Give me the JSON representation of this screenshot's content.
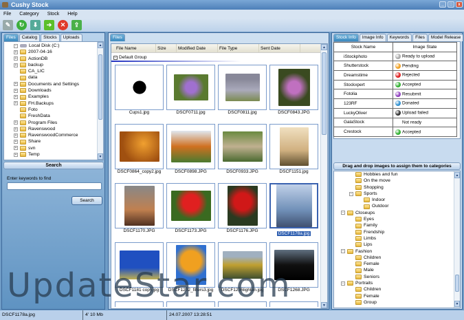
{
  "window": {
    "title": "Cushy Stock"
  },
  "menu": [
    "File",
    "Category",
    "Stock",
    "Help"
  ],
  "toolbar": [
    "wrench-icon",
    "refresh-icon",
    "download-icon",
    "arrow-right-icon",
    "cancel-icon",
    "upload-icon"
  ],
  "left": {
    "tabs": [
      "Files",
      "Catalog",
      "Stocks",
      "Uploads"
    ],
    "tree_root": "Local Disk (C:)",
    "tree": [
      {
        "l": "2007-04-16",
        "e": 1
      },
      {
        "l": "ActionDB",
        "e": 1
      },
      {
        "l": "backup",
        "e": 1
      },
      {
        "l": "CA_LIC",
        "e": 0
      },
      {
        "l": "data",
        "e": 0
      },
      {
        "l": "Documents and Settings",
        "e": 1
      },
      {
        "l": "Downloads",
        "e": 1
      },
      {
        "l": "Examples",
        "e": 1
      },
      {
        "l": "FH.Backups",
        "e": 1
      },
      {
        "l": "Foto",
        "e": 0
      },
      {
        "l": "FreshData",
        "e": 0
      },
      {
        "l": "Program Files",
        "e": 1
      },
      {
        "l": "Ravenswood",
        "e": 1
      },
      {
        "l": "RavenswoodCommerce",
        "e": 1
      },
      {
        "l": "Share",
        "e": 1
      },
      {
        "l": "svn",
        "e": 1
      },
      {
        "l": "Temp",
        "e": 1
      }
    ],
    "search_header": "Search",
    "search_label": "Enter keywords to find",
    "search_value": "",
    "search_button": "Search"
  },
  "center": {
    "tab": "Files",
    "columns": [
      "File Name",
      "Size",
      "Modified Date",
      "File Type",
      "Sent Date"
    ],
    "group": "Default Group",
    "thumbs": [
      "Cups1.jpg",
      "DSCF0711.jpg",
      "DSCF0811.jpg",
      "DSCF0843.JPG",
      "DSCF0864_copy2.jpg",
      "DSCF0898.JPG",
      "DSCF0933.JPG",
      "DSCF1151.jpg",
      "DSCF1170.JPG",
      "DSCF1173.JPG",
      "DSCF1176.JPG",
      "DSCF1178a.jpg",
      "DSCF1181 copy.jpg",
      "DSCF1202_filters3.jpg",
      "DSCF1236lighten.jpg",
      "DSCF1268.JPG"
    ],
    "selected": "DSCF1178a.jpg"
  },
  "right": {
    "tabs": [
      "Stock Info",
      "Image Info",
      "Keywords",
      "Files",
      "Model Release"
    ],
    "table_headers": [
      "Stock Name",
      "Image State"
    ],
    "stocks": [
      {
        "name": "iStockphoto",
        "state": "Ready to upload",
        "color": "#a8a8a8"
      },
      {
        "name": "Shutterstock",
        "state": "Pending",
        "color": "#f0a020"
      },
      {
        "name": "Dreamstime",
        "state": "Rejected",
        "color": "#e02020"
      },
      {
        "name": "Stockxpert",
        "state": "Accepted",
        "color": "#30b030"
      },
      {
        "name": "Fotolia",
        "state": "Resubmit",
        "color": "#9040c0"
      },
      {
        "name": "123RF",
        "state": "Donated",
        "color": "#3090d0"
      },
      {
        "name": "LuckyOliver",
        "state": "Upload failed",
        "color": "#303030"
      },
      {
        "name": "GalaStock",
        "state": "Not ready",
        "color": ""
      },
      {
        "name": "Crestock",
        "state": "Accepted",
        "color": "#30b030"
      }
    ],
    "categories_header": "Drag and drop images to assign them to categories",
    "categories": [
      {
        "l": "Hobbies and fun",
        "d": 2
      },
      {
        "l": "On the move",
        "d": 2
      },
      {
        "l": "Shopping",
        "d": 2
      },
      {
        "l": "Sports",
        "d": 2,
        "e": 1
      },
      {
        "l": "Indoor",
        "d": 3
      },
      {
        "l": "Outdoor",
        "d": 3
      },
      {
        "l": "Closeups",
        "d": 1,
        "e": 1
      },
      {
        "l": "Eyes",
        "d": 2
      },
      {
        "l": "Family",
        "d": 2
      },
      {
        "l": "Frendship",
        "d": 2
      },
      {
        "l": "Limbs",
        "d": 2
      },
      {
        "l": "Lips",
        "d": 2
      },
      {
        "l": "Fashion",
        "d": 1,
        "e": 1
      },
      {
        "l": "Children",
        "d": 2
      },
      {
        "l": "Female",
        "d": 2
      },
      {
        "l": "Male",
        "d": 2
      },
      {
        "l": "Seniors",
        "d": 2
      },
      {
        "l": "Portraits",
        "d": 1,
        "e": 1
      },
      {
        "l": "Children",
        "d": 2
      },
      {
        "l": "Female",
        "d": 2
      },
      {
        "l": "Group",
        "d": 2
      }
    ]
  },
  "status": {
    "file": "DSCF1178a.jpg",
    "size": "4' 10 Mb",
    "date": "24.07.2007 13:28:51"
  },
  "watermark": "UpdateStar.com"
}
